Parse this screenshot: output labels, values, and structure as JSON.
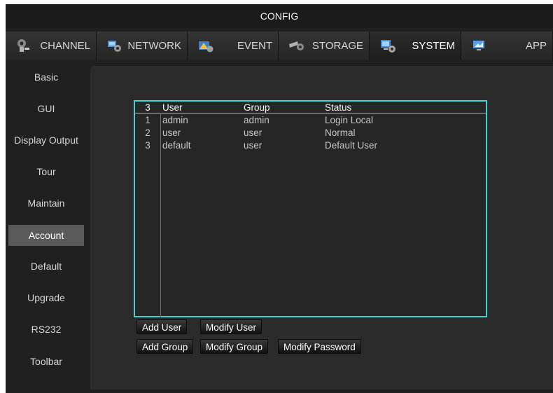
{
  "window": {
    "title": "CONFIG"
  },
  "tabs": [
    {
      "label": "CHANNEL",
      "icon": "channel-icon"
    },
    {
      "label": "NETWORK",
      "icon": "network-icon"
    },
    {
      "label": "EVENT",
      "icon": "event-icon"
    },
    {
      "label": "STORAGE",
      "icon": "storage-icon"
    },
    {
      "label": "SYSTEM",
      "icon": "system-icon"
    },
    {
      "label": "APP",
      "icon": "app-icon"
    }
  ],
  "active_tab": "SYSTEM",
  "sidebar": {
    "items": [
      {
        "label": "Basic"
      },
      {
        "label": "GUI"
      },
      {
        "label": "Display Output"
      },
      {
        "label": "Tour"
      },
      {
        "label": "Maintain"
      },
      {
        "label": "Account"
      },
      {
        "label": "Default"
      },
      {
        "label": "Upgrade"
      },
      {
        "label": "RS232"
      },
      {
        "label": "Toolbar"
      }
    ],
    "active": "Account"
  },
  "account_table": {
    "header": {
      "count": "3",
      "user": "User",
      "group": "Group",
      "status": "Status"
    },
    "rows": [
      {
        "num": "1",
        "user": "admin",
        "group": "admin",
        "status": "Login Local"
      },
      {
        "num": "2",
        "user": "user",
        "group": "user",
        "status": "Normal"
      },
      {
        "num": "3",
        "user": "default",
        "group": "user",
        "status": "Default User"
      }
    ]
  },
  "buttons": {
    "add_user": "Add User",
    "modify_user": "Modify User",
    "add_group": "Add Group",
    "modify_group": "Modify Group",
    "modify_password": "Modify Password"
  },
  "colors": {
    "accent_border": "#3fd2d2",
    "active_sidebar": "#5a5a5a",
    "background": "#202020"
  }
}
